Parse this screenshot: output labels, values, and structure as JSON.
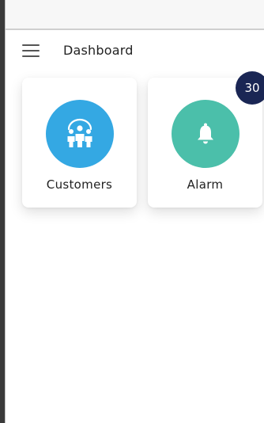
{
  "app_bar": {
    "title": "Dashboard"
  },
  "cards": [
    {
      "label": "Customers",
      "icon": "customers-group-icon",
      "color": "#34a8e3"
    },
    {
      "label": "Alarm",
      "icon": "bell-icon",
      "color": "#4bbfaa",
      "badge": "30",
      "badge_color": "#1a2654"
    }
  ]
}
